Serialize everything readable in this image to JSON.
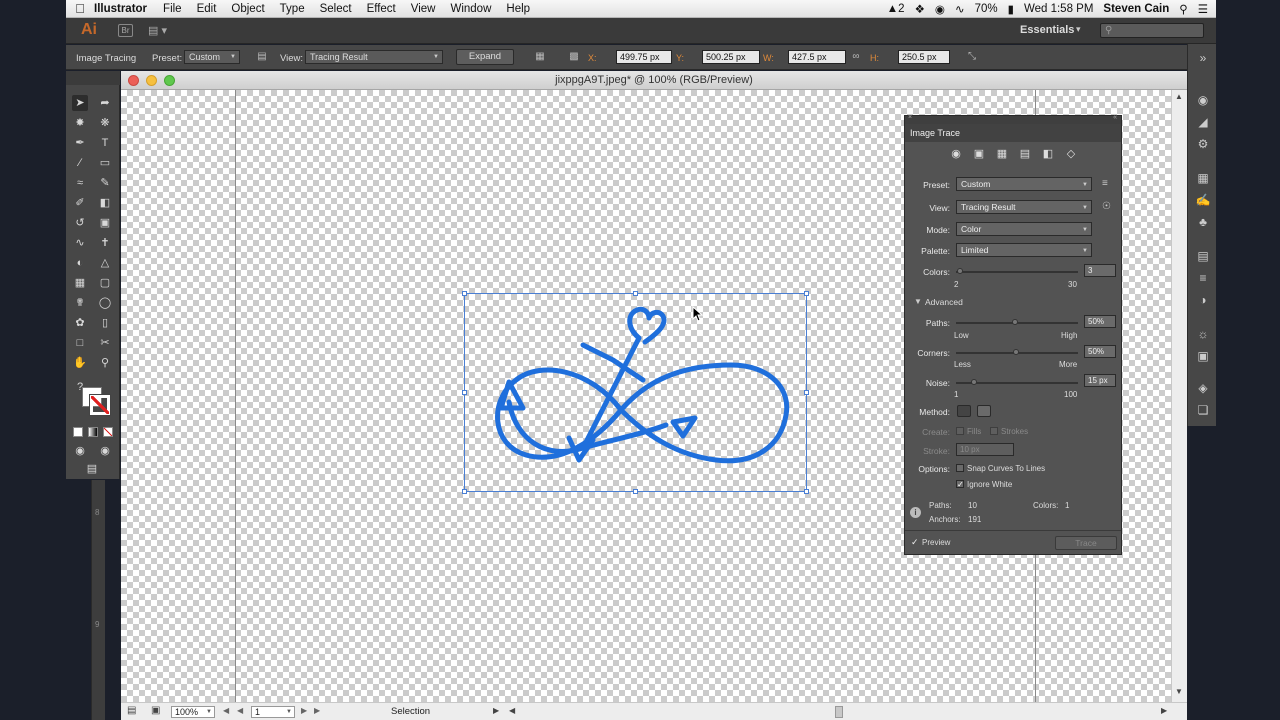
{
  "macmenu": {
    "app": "Illustrator",
    "items": [
      "File",
      "Edit",
      "Object",
      "Type",
      "Select",
      "Effect",
      "View",
      "Window",
      "Help"
    ],
    "status": {
      "notifications": "2",
      "battery": "70%",
      "clock": "Wed 1:58 PM",
      "user": "Steven Cain"
    }
  },
  "appbar": {
    "logo": "Ai",
    "br": "Br",
    "workspace": "Essentials"
  },
  "control": {
    "mode": "Image Tracing",
    "preset_label": "Preset:",
    "preset": "Custom",
    "view_label": "View:",
    "view": "Tracing Result",
    "expand": "Expand",
    "x_label": "X:",
    "x": "499.75 px",
    "y_label": "Y:",
    "y": "500.25 px",
    "w_label": "W:",
    "w": "427.5 px",
    "h_label": "H:",
    "h": "250.5 px"
  },
  "document": {
    "title": "jixppgA9T.jpeg* @ 100% (RGB/Preview)"
  },
  "statusbar": {
    "zoom": "100%",
    "artboard": "1",
    "tool": "Selection"
  },
  "ruler": {
    "marks": [
      "8",
      "9"
    ]
  },
  "trace_panel": {
    "title": "Image Trace",
    "preset_label": "Preset:",
    "preset": "Custom",
    "view_label": "View:",
    "view": "Tracing Result",
    "mode_label": "Mode:",
    "mode": "Color",
    "palette_label": "Palette:",
    "palette": "Limited",
    "colors_label": "Colors:",
    "colors_value": "3",
    "colors_min": "2",
    "colors_max": "30",
    "advanced": "Advanced",
    "paths_label": "Paths:",
    "paths_value": "50%",
    "paths_low": "Low",
    "paths_high": "High",
    "corners_label": "Corners:",
    "corners_value": "50%",
    "corners_low": "Less",
    "corners_high": "More",
    "noise_label": "Noise:",
    "noise_value": "15 px",
    "noise_min": "1",
    "noise_max": "100",
    "method_label": "Method:",
    "create_label": "Create:",
    "fills": "Fills",
    "strokes": "Strokes",
    "stroke_label": "Stroke:",
    "stroke_value": "10 px",
    "options_label": "Options:",
    "snap": "Snap Curves To Lines",
    "ignore_white": "Ignore White",
    "info_paths_label": "Paths:",
    "info_paths": "10",
    "info_colors_label": "Colors:",
    "info_colors": "1",
    "info_anchors_label": "Anchors:",
    "info_anchors": "191",
    "preview": "Preview",
    "trace": "Trace"
  },
  "colors": {
    "trace_blue": "#1f6fdc",
    "selection": "#4a7fd4",
    "ai_orange": "#c5682a"
  }
}
